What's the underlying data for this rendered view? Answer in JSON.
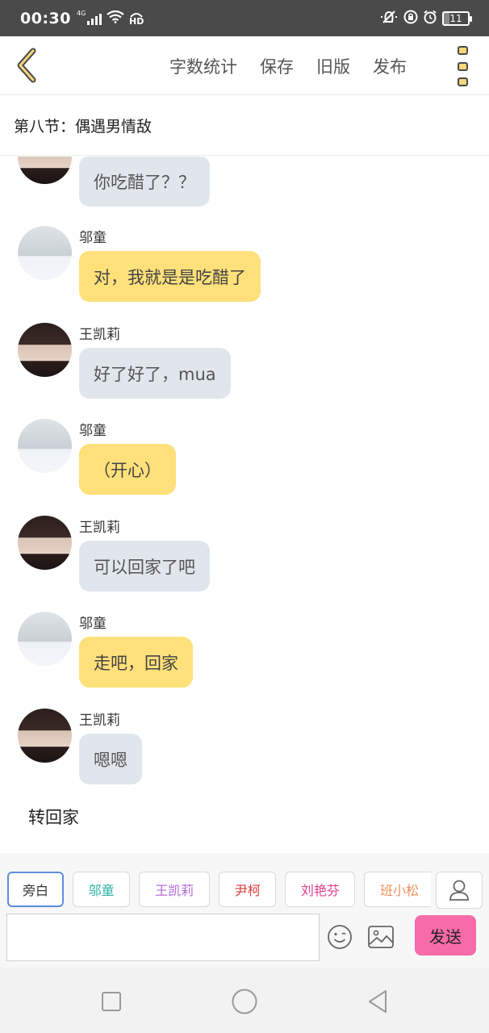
{
  "status_bar": {
    "time": "00:30",
    "network": "4G",
    "hd": "HD",
    "battery": "11"
  },
  "nav": {
    "actions": [
      "字数统计",
      "保存",
      "旧版",
      "发布"
    ]
  },
  "chapter": {
    "title": "第八节：偶遇男情敌"
  },
  "messages": [
    {
      "sender": "",
      "text": "你吃醋了？？",
      "avatar": "girl",
      "bubble": "gray"
    },
    {
      "sender": "邬童",
      "text": "对，我就是是吃醋了",
      "avatar": "boy",
      "bubble": "yellow"
    },
    {
      "sender": "王凯莉",
      "text": "好了好了，mua",
      "avatar": "girl",
      "bubble": "gray"
    },
    {
      "sender": "邬童",
      "text": "（开心）",
      "avatar": "boy",
      "bubble": "yellow"
    },
    {
      "sender": "王凯莉",
      "text": "可以回家了吧",
      "avatar": "girl",
      "bubble": "gray"
    },
    {
      "sender": "邬童",
      "text": "走吧，回家",
      "avatar": "boy",
      "bubble": "yellow"
    },
    {
      "sender": "王凯莉",
      "text": "嗯嗯",
      "avatar": "girl",
      "bubble": "gray"
    }
  ],
  "narration": "转回家",
  "characters": [
    {
      "name": "旁白",
      "color": "#333333",
      "active": true
    },
    {
      "name": "邬童",
      "color": "#2db3a5",
      "active": false
    },
    {
      "name": "王凯莉",
      "color": "#b16cd6",
      "active": false
    },
    {
      "name": "尹柯",
      "color": "#e03a3a",
      "active": false
    },
    {
      "name": "刘艳芬",
      "color": "#e0418e",
      "active": false
    },
    {
      "name": "班小松",
      "color": "#f0915a",
      "active": false
    }
  ],
  "composer": {
    "input_value": "",
    "send_label": "发送"
  },
  "colors": {
    "accent_yellow": "#ffe07a",
    "bubble_gray": "#e1e6ed",
    "send_pink": "#f76ba8",
    "active_chip_border": "#5b8ede"
  }
}
